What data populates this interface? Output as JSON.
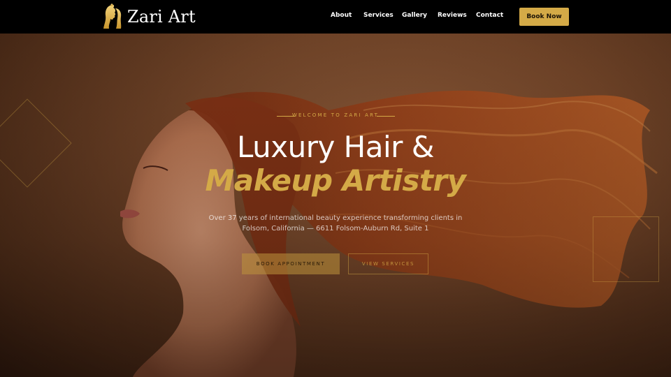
{
  "brand": {
    "name": "Zari Art",
    "logo_icon": "woman-silhouette-icon",
    "accent_color": "#d4aa47"
  },
  "nav": {
    "links": [
      "About",
      "Services",
      "Gallery",
      "Reviews",
      "Contact"
    ],
    "cta": "Book Now"
  },
  "hero": {
    "eyebrow": "WELCOME TO ZARI ART",
    "headline_line1": "Luxury Hair &",
    "headline_line2": "Makeup Artistry",
    "subtitle_line1": "Over 37 years of international beauty experience transforming clients in",
    "subtitle_line2": "Folsom, California — 6611 Folsom-Auburn Rd, Suite 1",
    "primary_button": "BOOK APPOINTMENT",
    "secondary_button": "VIEW SERVICES",
    "image": "woman-with-flowing-red-hair-photo"
  }
}
